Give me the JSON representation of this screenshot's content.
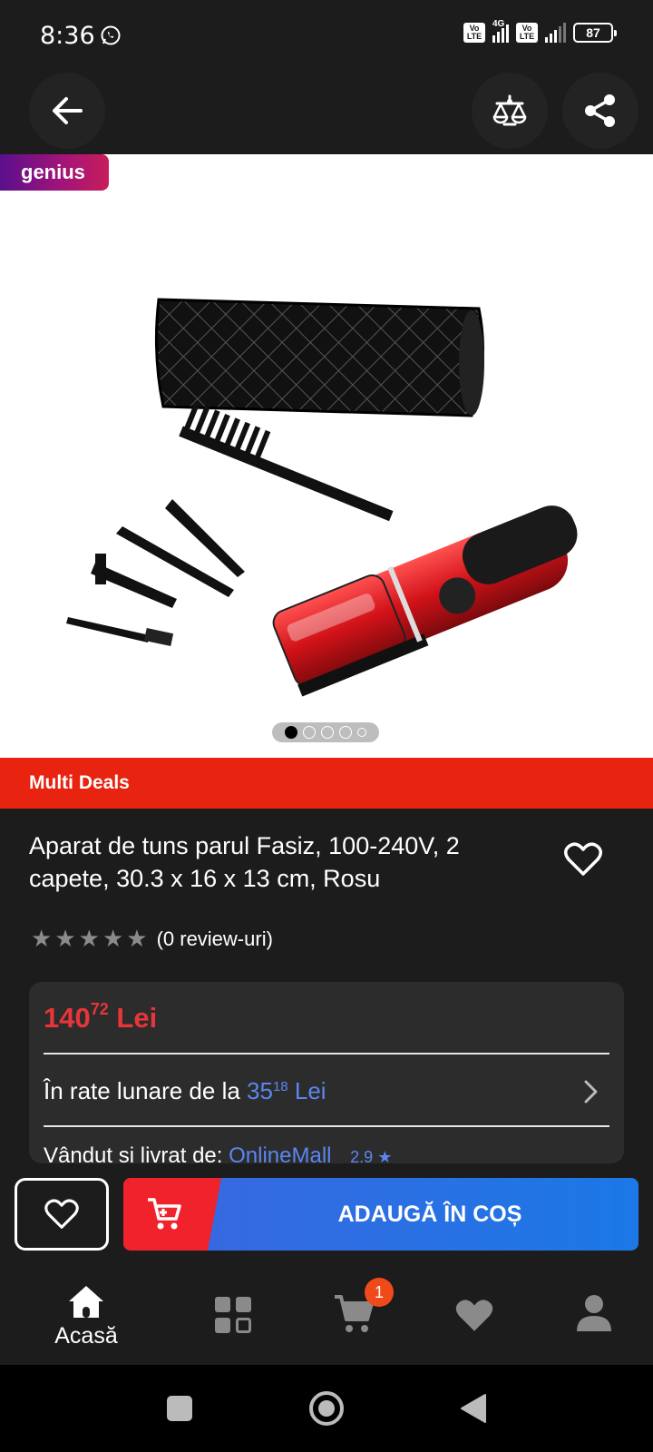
{
  "status_bar": {
    "time": "8:36",
    "network_label": "4G",
    "volte_label": "Vo LTE",
    "battery": "87"
  },
  "gallery": {
    "badge": "genius",
    "image_count": 5,
    "active_index": 0
  },
  "banner": {
    "label": "Multi Deals",
    "color": "#e8230f"
  },
  "product": {
    "title": "Aparat de tuns parul Fasiz, 100-240V, 2 capete, 30.3 x 16 x 13 cm, Rosu",
    "rating_stars": 0,
    "review_text": "(0 review-uri)"
  },
  "price": {
    "integer": "140",
    "decimals": "72",
    "currency": "Lei",
    "color": "#e8353a"
  },
  "installments": {
    "prefix": "În rate lunare de la",
    "integer": "35",
    "decimals": "18",
    "currency": "Lei"
  },
  "seller": {
    "prefix": "Vândut și livrat de:",
    "name": "OnlineMall",
    "rating": "2.9",
    "rating_icon": "star-icon"
  },
  "actions": {
    "add_to_cart": "ADAUGĂ ÎN COȘ"
  },
  "bottom_nav": {
    "home_label": "Acasă",
    "cart_badge": "1",
    "items": [
      "home-icon",
      "categories-icon",
      "cart-icon",
      "favorites-icon",
      "account-icon"
    ]
  },
  "top_nav": {
    "icons": [
      "back-arrow-icon",
      "compare-scale-icon",
      "share-icon"
    ]
  }
}
